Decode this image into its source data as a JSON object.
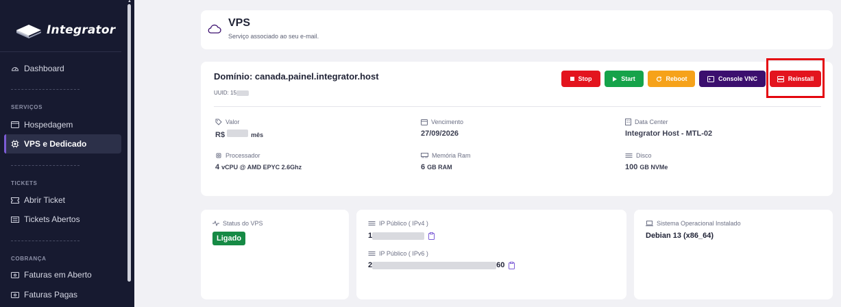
{
  "sidebar": {
    "brand": "Integrator",
    "dashboard": "Dashboard",
    "section_servicos": "SERVIÇOS",
    "hospedagem": "Hospedagem",
    "vps": "VPS e Dedicado",
    "section_tickets": "TICKETS",
    "abrir_ticket": "Abrir Ticket",
    "tickets_abertos": "Tickets Abertos",
    "section_cobranca": "COBRANÇA",
    "faturas_aberto": "Faturas em Aberto",
    "faturas_pagas": "Faturas Pagas"
  },
  "header": {
    "title": "VPS",
    "subtitle": "Serviço associado ao seu e-mail."
  },
  "main": {
    "dominio": "Domínio: canada.painel.integrator.host",
    "uuid_label": "UUID: 15",
    "buttons": {
      "stop": "Stop",
      "start": "Start",
      "reboot": "Reboot",
      "console": "Console VNC",
      "reinstall": "Reinstall"
    },
    "valor_label": "Valor",
    "valor_prefix": "R$",
    "valor_suffix": "mês",
    "vencimento_label": "Vencimento",
    "vencimento_value": "27/09/2026",
    "datacenter_label": "Data Center",
    "datacenter_value": "Integrator Host - MTL-02",
    "processador_label": "Processador",
    "processador_num": "4",
    "processador_value": "vCPU @ AMD EPYC 2.6Ghz",
    "memoria_label": "Memória Ram",
    "memoria_num": "6",
    "memoria_value": "GB RAM",
    "disco_label": "Disco",
    "disco_num": "100",
    "disco_value": "GB NVMe"
  },
  "status_card": {
    "label": "Status do VPS",
    "badge": "Ligado"
  },
  "ip_card": {
    "ipv4_label": "IP Público ( IPv4 )",
    "ipv4_start": "1",
    "ipv6_label": "IP Público ( IPv6 )",
    "ipv6_start": "2",
    "ipv6_end": "60"
  },
  "os_card": {
    "label": "Sistema Operacional Instalado",
    "value": "Debian 13 (x86_64)"
  },
  "colors": {
    "sidebar_bg": "#171a30",
    "accent": "#7c5cd6",
    "stop": "#e3141e",
    "start": "#16a34a",
    "reboot": "#f6a21a",
    "console": "#3b0f6e",
    "status_green": "#168a45",
    "highlight": "#e4050d"
  }
}
